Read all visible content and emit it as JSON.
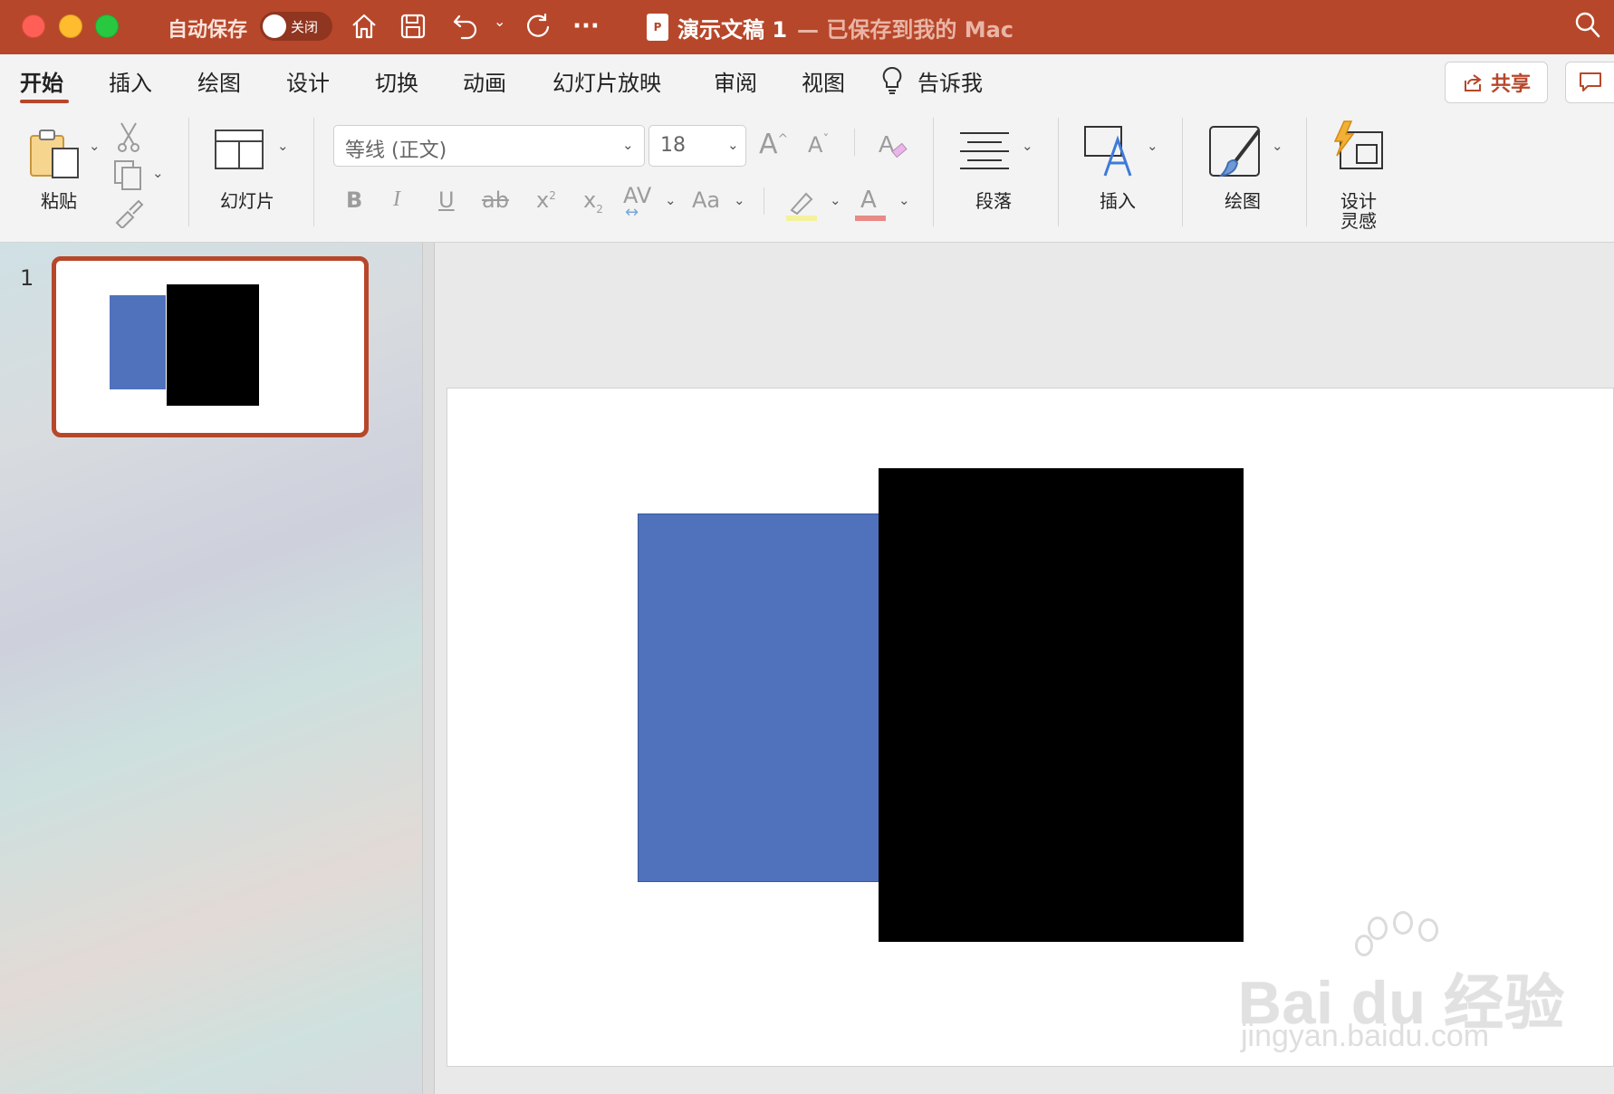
{
  "titlebar": {
    "autosave_label": "自动保存",
    "autosave_state": "关闭",
    "doc_icon_text": "P",
    "doc_title": "演示文稿 1",
    "doc_subtitle": "— 已保存到我的 Mac"
  },
  "tabs": [
    {
      "label": "开始",
      "active": true
    },
    {
      "label": "插入"
    },
    {
      "label": "绘图"
    },
    {
      "label": "设计"
    },
    {
      "label": "切换"
    },
    {
      "label": "动画"
    },
    {
      "label": "幻灯片放映"
    },
    {
      "label": "审阅"
    },
    {
      "label": "视图"
    },
    {
      "label": "告诉我"
    }
  ],
  "share": {
    "label": "共享"
  },
  "ribbon": {
    "paste_label": "粘贴",
    "slide_label": "幻灯片",
    "font_name": "等线 (正文)",
    "font_size": "18",
    "paragraph_label": "段落",
    "insert_label": "插入",
    "draw_label": "绘图",
    "designer_label_1": "设计",
    "designer_label_2": "灵感",
    "bold": "B",
    "italic": "I",
    "underline": "U",
    "strike": "ab",
    "superscript": "x",
    "subscript": "x",
    "spacing": "AV",
    "case": "Aa",
    "font_color_glyph": "A"
  },
  "slides_panel": {
    "slide_number": "1"
  },
  "colors": {
    "accent": "#b7472a",
    "shape_blue": "#5072bc",
    "shape_black": "#000000"
  },
  "watermark": {
    "brand": "Bai du 经验",
    "url": "jingyan.baidu.com"
  }
}
